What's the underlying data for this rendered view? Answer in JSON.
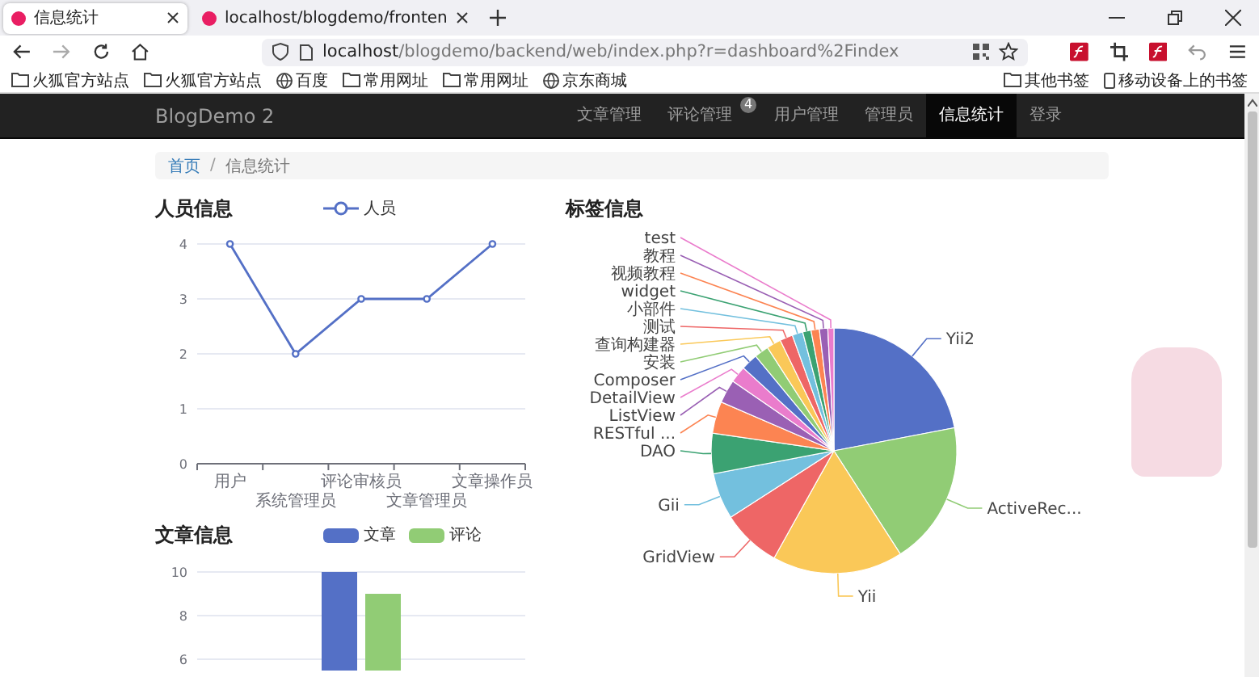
{
  "browser": {
    "tabs": [
      {
        "title": "信息统计",
        "selected": true
      },
      {
        "title": "localhost/blogdemo/fronten",
        "selected": false
      }
    ],
    "address": {
      "host": "localhost",
      "path": "/blogdemo/backend/web/index.php?r=dashboard%2Findex"
    },
    "bookmarks": [
      {
        "label": "火狐官方站点",
        "kind": "folder"
      },
      {
        "label": "火狐官方站点",
        "kind": "folder"
      },
      {
        "label": "百度",
        "kind": "globe"
      },
      {
        "label": "常用网址",
        "kind": "folder"
      },
      {
        "label": "常用网址",
        "kind": "folder"
      },
      {
        "label": "京东商城",
        "kind": "globe"
      }
    ],
    "other_bookmarks": [
      {
        "label": "其他书签",
        "kind": "folder"
      },
      {
        "label": "移动设备上的书签",
        "kind": "device"
      }
    ]
  },
  "navbar": {
    "brand": "BlogDemo 2",
    "items": [
      {
        "label": "文章管理",
        "selected": false
      },
      {
        "label": "评论管理",
        "selected": false,
        "badge": "4"
      },
      {
        "label": "用户管理",
        "selected": false
      },
      {
        "label": "管理员",
        "selected": false
      },
      {
        "label": "信息统计",
        "selected": true
      },
      {
        "label": "登录",
        "selected": false
      }
    ]
  },
  "breadcrumb": {
    "separator": "/",
    "items": [
      {
        "label": "首页",
        "kind": "link"
      },
      {
        "label": "信息统计",
        "kind": "current"
      }
    ]
  },
  "people": {
    "title": "人员信息",
    "chart_data": {
      "type": "line",
      "categories": [
        "用户",
        "系统管理员",
        "评论审核员",
        "文章管理员",
        "文章操作员"
      ],
      "ylim": [
        0,
        4
      ],
      "yticks": [
        0,
        1,
        2,
        3,
        4
      ],
      "grid": true,
      "series": [
        {
          "name": "人员",
          "color": "#5470c6",
          "marker": "circle",
          "values": [
            4,
            2,
            3,
            3,
            4
          ]
        }
      ]
    }
  },
  "tags": {
    "title": "标签信息",
    "chart_data": {
      "type": "pie",
      "categories": [
        "Yii2",
        "ActiveRec...",
        "Yii",
        "GridView",
        "Gii",
        "DAO",
        "RESTful ...",
        "ListView",
        "DetailView",
        "Composer",
        "安装",
        "查询构建器",
        "测试",
        "小部件",
        "widget",
        "视频教程",
        "教程",
        "test"
      ],
      "values": [
        22.0,
        18.9,
        17.2,
        7.8,
        6.1,
        5.3,
        4.2,
        3.1,
        2.2,
        2.2,
        1.9,
        1.9,
        1.7,
        1.4,
        1.1,
        1.1,
        1.1,
        0.8
      ]
    }
  },
  "articles": {
    "title": "文章信息",
    "chart_data": {
      "type": "bar",
      "ylim": [
        5.3,
        10
      ],
      "yticks": [
        6,
        8,
        10
      ],
      "grid": true,
      "series": [
        {
          "name": "文章",
          "color": "#5470c6",
          "values": [
            10
          ]
        },
        {
          "name": "评论",
          "color": "#91cc75",
          "values": [
            9
          ]
        }
      ]
    }
  }
}
